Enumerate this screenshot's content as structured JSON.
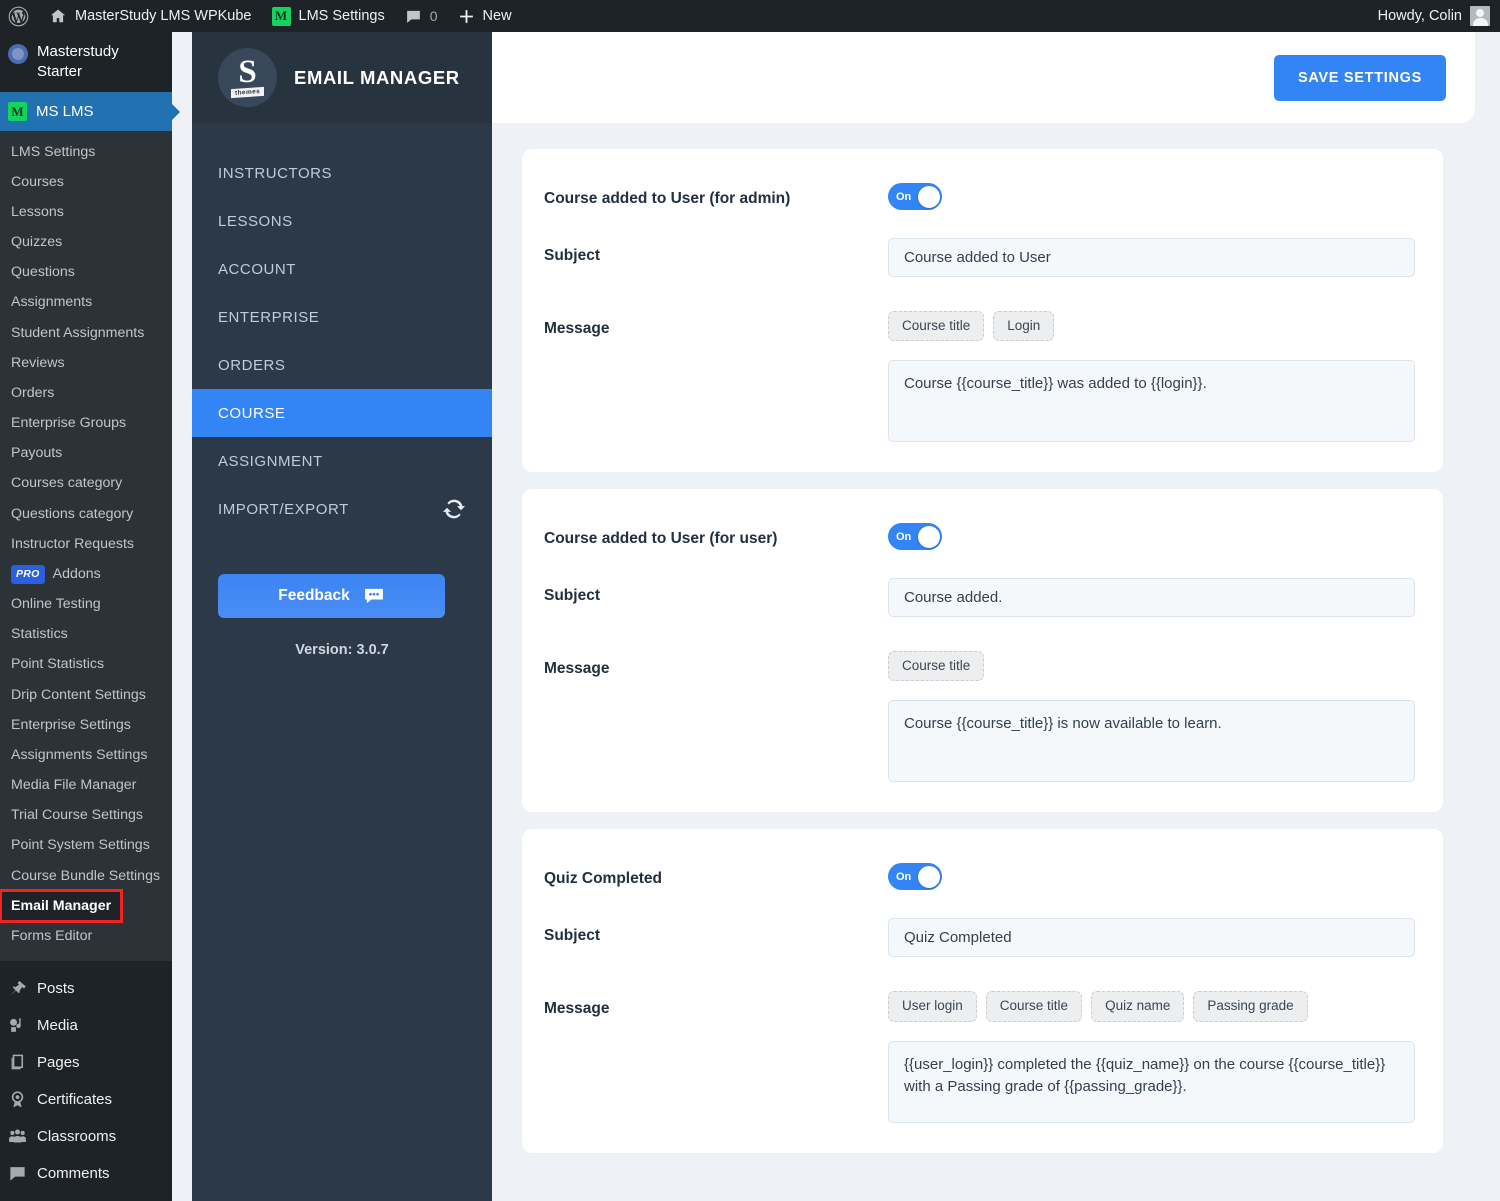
{
  "adminbar": {
    "wp_logo": "wordpress-logo-icon",
    "site_name": "MasterStudy LMS WPKube",
    "lms_settings": "LMS Settings",
    "lms_badge": "M",
    "comment_count": "0",
    "new_label": "New",
    "howdy": "Howdy, Colin"
  },
  "wp_sidebar": {
    "theme_name": "Masterstudy Starter",
    "current_menu": "MS LMS",
    "current_badge": "M",
    "submenu": [
      {
        "label": "LMS Settings"
      },
      {
        "label": "Courses"
      },
      {
        "label": "Lessons"
      },
      {
        "label": "Quizzes"
      },
      {
        "label": "Questions"
      },
      {
        "label": "Assignments"
      },
      {
        "label": "Student Assignments"
      },
      {
        "label": "Reviews"
      },
      {
        "label": "Orders"
      },
      {
        "label": "Enterprise Groups"
      },
      {
        "label": "Payouts"
      },
      {
        "label": "Courses category"
      },
      {
        "label": "Questions category"
      },
      {
        "label": "Instructor Requests"
      }
    ],
    "pro_tag": "PRO",
    "pro_label": "Addons",
    "submenu2": [
      {
        "label": "Online Testing"
      },
      {
        "label": "Statistics"
      },
      {
        "label": "Point Statistics"
      },
      {
        "label": "Drip Content Settings"
      },
      {
        "label": "Enterprise Settings"
      },
      {
        "label": "Assignments Settings"
      },
      {
        "label": "Media File Manager"
      },
      {
        "label": "Trial Course Settings"
      },
      {
        "label": "Point System Settings"
      },
      {
        "label": "Course Bundle Settings"
      }
    ],
    "highlighted_item": "Email Manager",
    "after_highlight": [
      {
        "label": "Forms Editor"
      }
    ],
    "main_menu": [
      {
        "label": "Posts",
        "icon": "pin-icon"
      },
      {
        "label": "Media",
        "icon": "media-icon"
      },
      {
        "label": "Pages",
        "icon": "pages-icon"
      },
      {
        "label": "Certificates",
        "icon": "award-icon"
      },
      {
        "label": "Classrooms",
        "icon": "users-icon"
      },
      {
        "label": "Comments",
        "icon": "comment-icon"
      }
    ]
  },
  "plugin": {
    "brand_letter": "S",
    "brand_sub": "themes",
    "brand_title": "EMAIL MANAGER",
    "nav": [
      {
        "label": "INSTRUCTORS",
        "active": false
      },
      {
        "label": "LESSONS",
        "active": false
      },
      {
        "label": "ACCOUNT",
        "active": false
      },
      {
        "label": "ENTERPRISE",
        "active": false
      },
      {
        "label": "ORDERS",
        "active": false
      },
      {
        "label": "COURSE",
        "active": true
      },
      {
        "label": "ASSIGNMENT",
        "active": false
      },
      {
        "label": "IMPORT/EXPORT",
        "active": false,
        "icon": "sync-icon"
      }
    ],
    "feedback_label": "Feedback",
    "feedback_icon": "chat-bubble-icon",
    "version": "Version: 3.0.7",
    "accent_color": "#3384f4"
  },
  "topbar": {
    "save_label": "SAVE SETTINGS"
  },
  "labels": {
    "subject": "Subject",
    "message": "Message",
    "toggle_on": "On"
  },
  "cards": [
    {
      "title": "Course added to User (for admin)",
      "enabled": true,
      "toggle_text": "On",
      "subject": "Course added to User",
      "chips": [
        "Course title",
        "Login"
      ],
      "message": "Course {{course_title}} was added to {{login}}."
    },
    {
      "title": "Course added to User (for user)",
      "enabled": true,
      "toggle_text": "On",
      "subject": "Course added.",
      "chips": [
        "Course title"
      ],
      "message": "Course {{course_title}} is now available to learn."
    },
    {
      "title": "Quiz Completed",
      "enabled": true,
      "toggle_text": "On",
      "subject": "Quiz Completed",
      "chips": [
        "User login",
        "Course title",
        "Quiz name",
        "Passing grade"
      ],
      "message": "{{user_login}} completed the {{quiz_name}} on the course {{course_title}} with a Passing grade of {{passing_grade}}."
    }
  ]
}
